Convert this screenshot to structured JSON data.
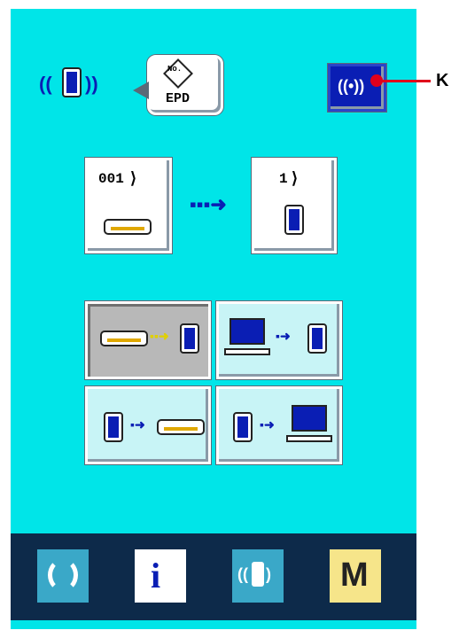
{
  "header": {
    "epd_icon_top": "No.",
    "epd_label": "EPD"
  },
  "transfer": {
    "source_number": "001",
    "dest_number": "1"
  },
  "annotation": {
    "label": "K"
  },
  "bottom_bar": {
    "m_label": "M",
    "info_label": "i"
  }
}
